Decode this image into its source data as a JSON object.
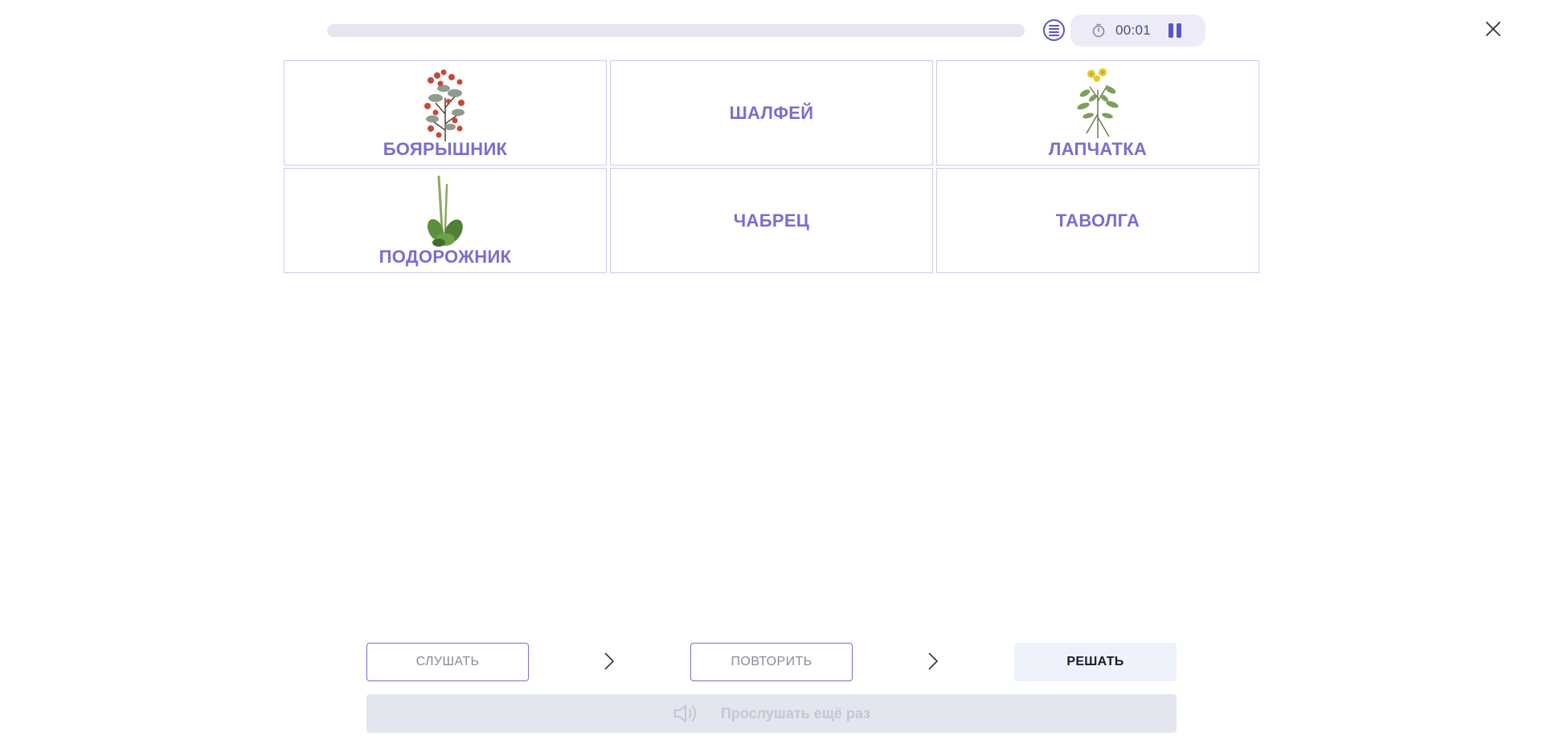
{
  "progress": {
    "fraction": 0
  },
  "timer": {
    "time": "00:01"
  },
  "icons": {
    "list": "list-icon",
    "timer": "stopwatch-icon",
    "pause": "pause-icon",
    "close": "close-icon",
    "chevron": "chevron-right-icon",
    "speaker": "speaker-icon"
  },
  "cards": [
    {
      "label": "БОЯРЫШНИК",
      "image": "hawthorn-illustration"
    },
    {
      "label": "ШАЛФЕЙ"
    },
    {
      "label": "ЛАПЧАТКА",
      "image": "cinquefoil-illustration"
    },
    {
      "label": "ПОДОРОЖНИК",
      "image": "plantain-illustration"
    },
    {
      "label": "ЧАБРЕЦ"
    },
    {
      "label": "ТАВОЛГА"
    }
  ],
  "steps": {
    "listen": "СЛУШАТЬ",
    "repeat": "ПОВТОРИТЬ",
    "solve": "РЕШАТЬ"
  },
  "listen_again": "Прослушать ещё раз",
  "colors": {
    "accent": "#7a6dcf",
    "accent_dark": "#5a55c8",
    "card_border": "#cfcbed"
  }
}
